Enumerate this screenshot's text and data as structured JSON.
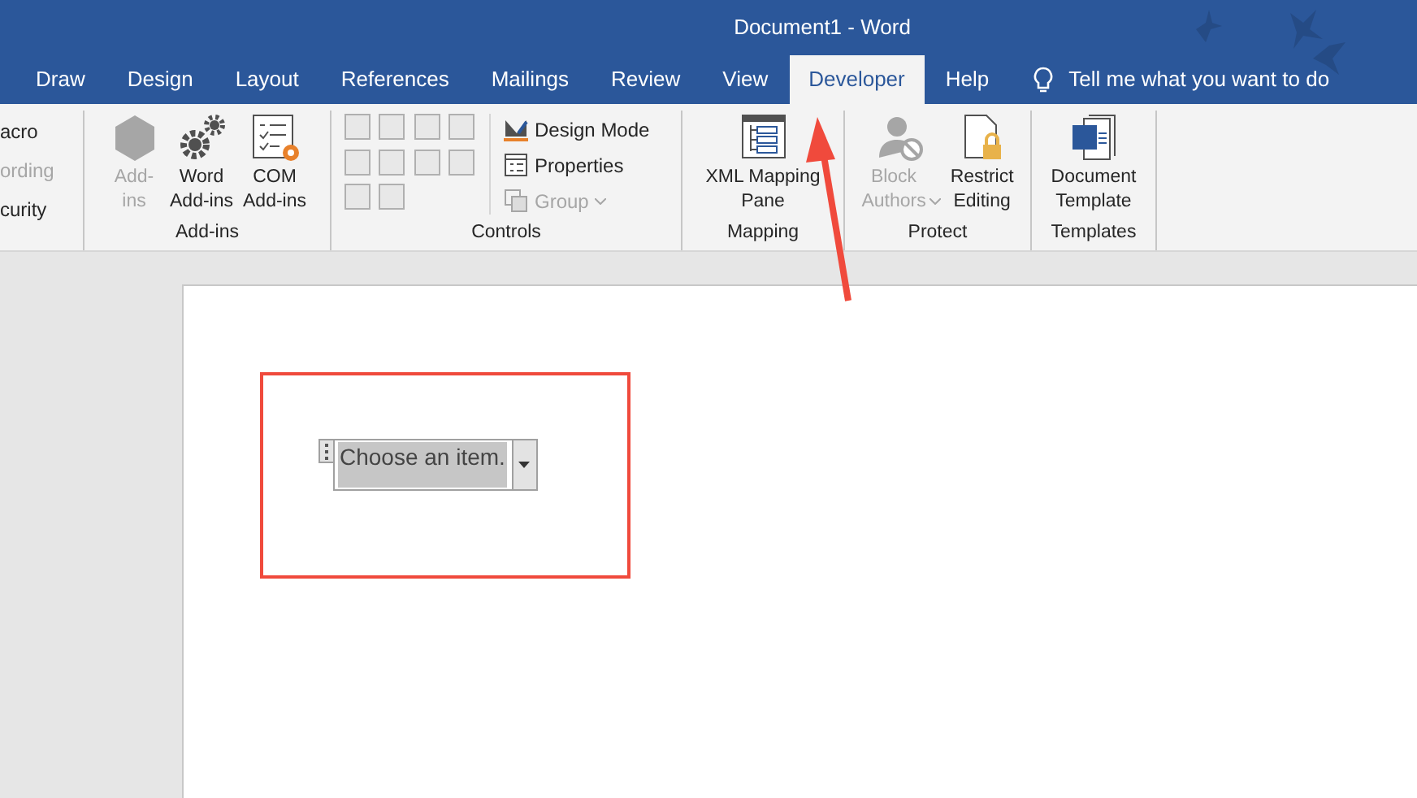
{
  "window": {
    "title": "Document1  -  Word"
  },
  "tabs": [
    {
      "label": "Draw",
      "selected": false
    },
    {
      "label": "Design",
      "selected": false
    },
    {
      "label": "Layout",
      "selected": false
    },
    {
      "label": "References",
      "selected": false
    },
    {
      "label": "Mailings",
      "selected": false
    },
    {
      "label": "Review",
      "selected": false
    },
    {
      "label": "View",
      "selected": false
    },
    {
      "label": "Developer",
      "selected": true
    },
    {
      "label": "Help",
      "selected": false
    }
  ],
  "tell_me": {
    "placeholder": "Tell me what you want to do"
  },
  "ribbon": {
    "groups": [
      {
        "buttons": [
          {
            "kind": "small",
            "label": "acro",
            "disabled": false
          },
          {
            "kind": "small",
            "label": "ording",
            "disabled": true
          },
          {
            "kind": "small",
            "label": "curity",
            "disabled": false
          }
        ]
      },
      {
        "label": "Add-ins",
        "buttons": [
          {
            "kind": "large",
            "label": "Add-\nins",
            "disabled": true
          },
          {
            "kind": "large",
            "label": "Word\nAdd-ins",
            "disabled": false
          },
          {
            "kind": "large",
            "label": "COM\nAdd-ins",
            "disabled": false
          }
        ]
      },
      {
        "label": "Controls",
        "buttons": [
          {
            "kind": "small",
            "label": "Design Mode",
            "disabled": false
          },
          {
            "kind": "small",
            "label": "Properties",
            "disabled": false
          },
          {
            "kind": "small",
            "label": "Group",
            "disabled": true,
            "dropdown": true
          }
        ]
      },
      {
        "label": "Mapping",
        "buttons": [
          {
            "kind": "large",
            "label": "XML Mapping\nPane",
            "disabled": false
          }
        ]
      },
      {
        "label": "Protect",
        "buttons": [
          {
            "kind": "large",
            "label": "Block\nAuthors",
            "disabled": true,
            "dropdown": true
          },
          {
            "kind": "large",
            "label": "Restrict\nEditing",
            "disabled": false
          }
        ]
      },
      {
        "label": "Templates",
        "buttons": [
          {
            "kind": "large",
            "label": "Document\nTemplate",
            "disabled": false
          }
        ]
      }
    ]
  },
  "document": {
    "content_control": {
      "placeholder": "Choose an item."
    }
  }
}
